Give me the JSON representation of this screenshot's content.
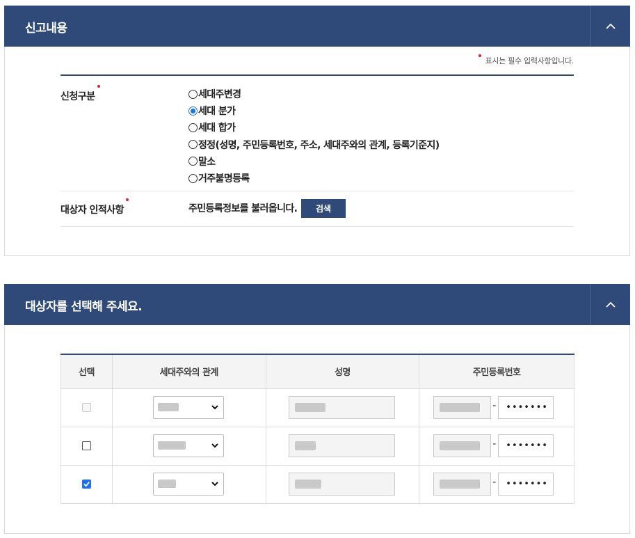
{
  "report_panel": {
    "title": "신고내용",
    "required_note": "표시는 필수 입력사항입니다.",
    "request_type": {
      "label": "신청구분",
      "options": [
        "세대주변경",
        "세대 분가",
        "세대 합가",
        "정정(성명, 주민등록번호, 주소, 세대주와의 관계, 등록기준지)",
        "말소",
        "거주불명등록"
      ],
      "selected": "세대 분가"
    },
    "target_info": {
      "label": "대상자 인적사항",
      "lookup_text": "주민등록정보를 불러옵니다.",
      "search_label": "검색"
    },
    "toggle_icon": "chevron-up-icon"
  },
  "target_panel": {
    "title": "대상자를 선택해 주세요.",
    "toggle_icon": "chevron-up-icon",
    "columns": [
      "선택",
      "세대주와의 관계",
      "성명",
      "주민등록번호"
    ],
    "rows": [
      {
        "checked": false,
        "disabled": true,
        "rrn_back": "•••••••"
      },
      {
        "checked": false,
        "disabled": false,
        "rrn_back": "•••••••"
      },
      {
        "checked": true,
        "disabled": false,
        "rrn_back": "•••••••"
      }
    ],
    "rrn_separator": "-"
  },
  "colors": {
    "header_bg": "#2f4a78",
    "required_dot": "#e0202a",
    "checkbox_checked": "#1a73e8"
  }
}
